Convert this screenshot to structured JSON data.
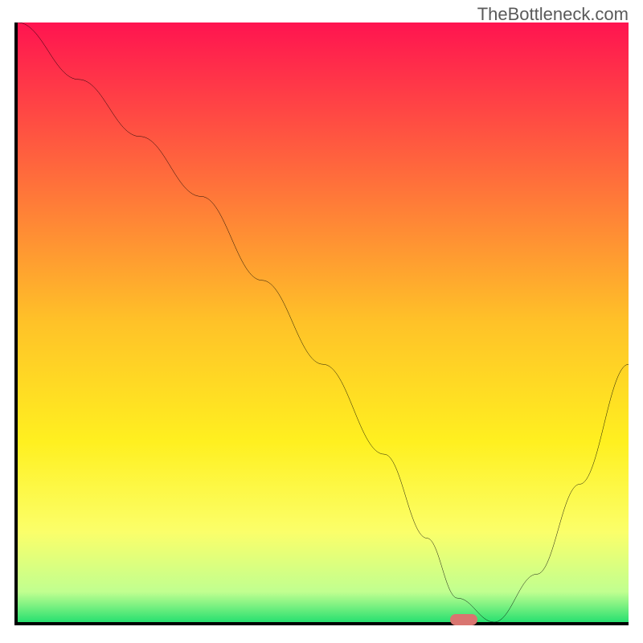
{
  "watermark": "TheBottleneck.com",
  "chart_data": {
    "type": "line",
    "title": "",
    "xlabel": "",
    "ylabel": "",
    "xlim": [
      0,
      100
    ],
    "ylim": [
      0,
      100
    ],
    "x": [
      0,
      10,
      20,
      30,
      40,
      50,
      60,
      67,
      72,
      78,
      85,
      92,
      100
    ],
    "values": [
      100,
      90.5,
      81,
      71,
      57,
      43,
      28,
      14,
      4,
      0,
      8,
      23,
      43
    ],
    "marker_position": {
      "x": 73,
      "y": 0
    },
    "gradient_stops": [
      {
        "offset": 0,
        "color": "#ff1450"
      },
      {
        "offset": 25,
        "color": "#ff6a3c"
      },
      {
        "offset": 50,
        "color": "#ffc228"
      },
      {
        "offset": 70,
        "color": "#fff020"
      },
      {
        "offset": 85,
        "color": "#fbff6a"
      },
      {
        "offset": 95,
        "color": "#c0ff90"
      },
      {
        "offset": 100,
        "color": "#28e070"
      }
    ]
  }
}
